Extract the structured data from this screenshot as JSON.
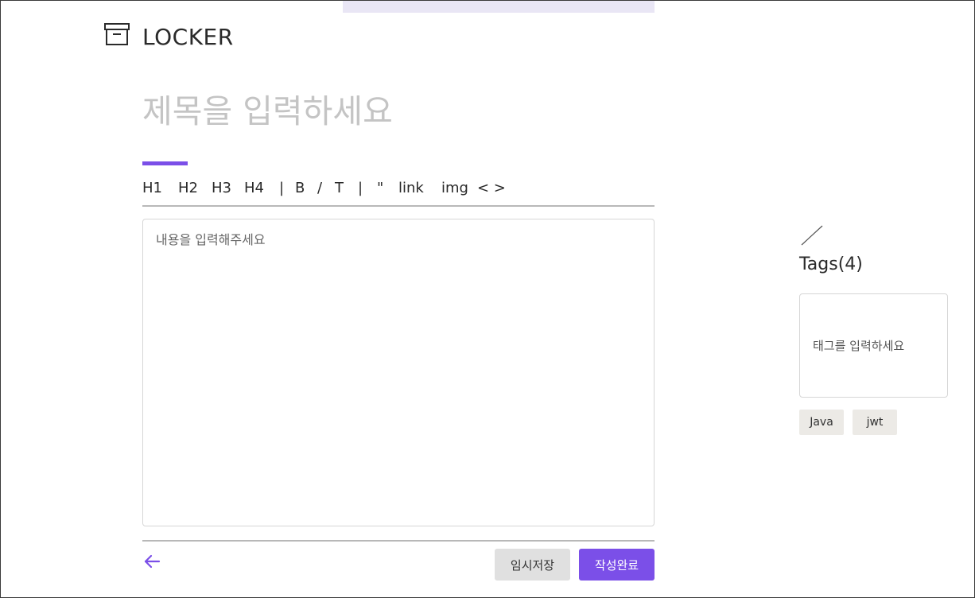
{
  "app": {
    "logo_text": "LOCKER",
    "accent_color": "#7b4fe8"
  },
  "editor": {
    "title_placeholder": "제목을 입력하세요",
    "body_placeholder": "내용을 입력해주세요",
    "toolbar": {
      "h1": "H1",
      "h2": "H2",
      "h3": "H3",
      "h4": "H4",
      "separator": "|",
      "bold": "B",
      "italic": "/",
      "strike": "T",
      "quote": "\"",
      "link": "link",
      "img": "img",
      "code": "< >"
    }
  },
  "actions": {
    "save_draft_label": "임시저장",
    "publish_label": "작성완료",
    "back_icon": "arrow-left-icon"
  },
  "tags": {
    "title": "Tags(4)",
    "input_placeholder": "태그를 입력하세요",
    "items": [
      "Java",
      "jwt"
    ]
  }
}
